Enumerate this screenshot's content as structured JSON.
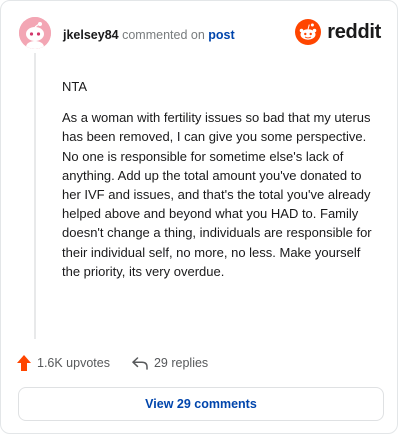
{
  "comment": {
    "username": "jkelsey84",
    "commented_on_text": "commented on",
    "post_link": "post",
    "paragraphs": [
      "NTA",
      "As a woman with fertility issues so bad that my uterus has been removed, I can give you some perspective. No one is responsible for sometime else's lack of anything. Add up the total amount you've donated to her IVF and issues, and that's the total you've already helped above and beyond what you HAD to. Family doesn't change a thing, individuals are responsible for their individual self, no more, no less. Make yourself the priority, its very overdue."
    ]
  },
  "brand": {
    "name": "reddit",
    "icon": "reddit-snoo-icon",
    "color": "#ff4500"
  },
  "actions": {
    "upvotes_label": "1.6K upvotes",
    "upvote_icon": "upvote-arrow-icon",
    "upvote_color": "#ff4500",
    "replies_label": "29 replies",
    "reply_icon": "reply-arrow-icon"
  },
  "footer": {
    "view_comments_label": "View 29 comments"
  },
  "colors": {
    "link": "#0045ac",
    "muted": "#787c7e",
    "avatar_bg": "#f3a6b4"
  }
}
